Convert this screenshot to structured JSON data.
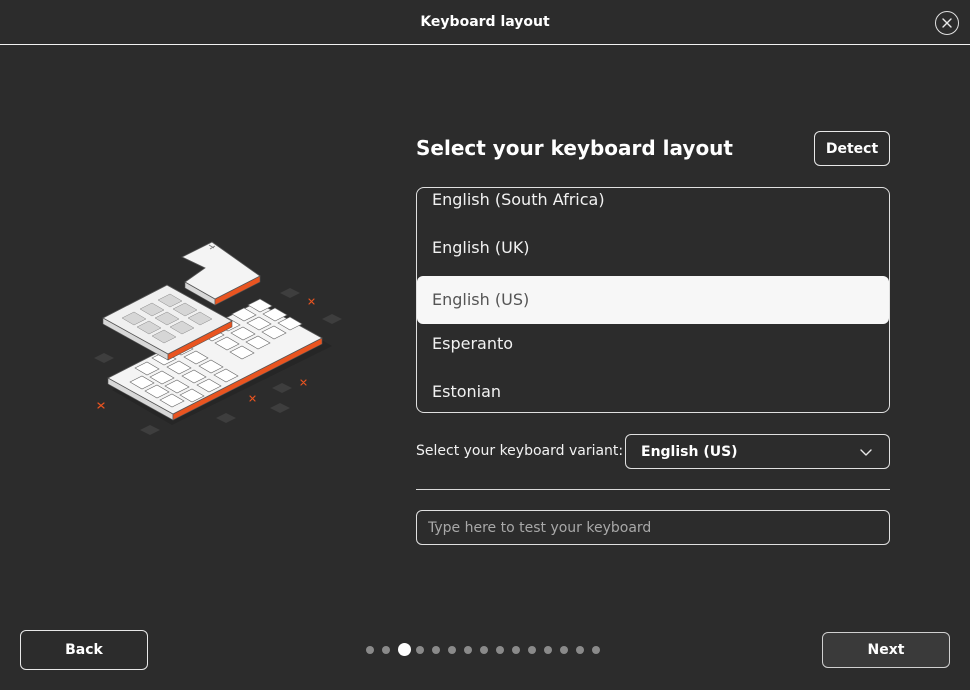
{
  "window": {
    "title": "Keyboard layout",
    "close_icon": "close-icon"
  },
  "main": {
    "heading": "Select your keyboard layout",
    "detect_label": "Detect",
    "layouts": [
      {
        "label": "English (South Africa)",
        "selected": false
      },
      {
        "label": "English (UK)",
        "selected": false
      },
      {
        "label": "English (US)",
        "selected": true
      },
      {
        "label": "Esperanto",
        "selected": false
      },
      {
        "label": "Estonian",
        "selected": false
      }
    ],
    "variant_label": "Select your keyboard variant:",
    "variant_value": "English (US)",
    "test_placeholder": "Type here to test your keyboard"
  },
  "footer": {
    "back_label": "Back",
    "next_label": "Next",
    "steps_total": 15,
    "current_step": 3
  },
  "colors": {
    "background": "#2c2c2c",
    "accent_orange": "#e95420",
    "selected_row": "#f7f7f7"
  }
}
